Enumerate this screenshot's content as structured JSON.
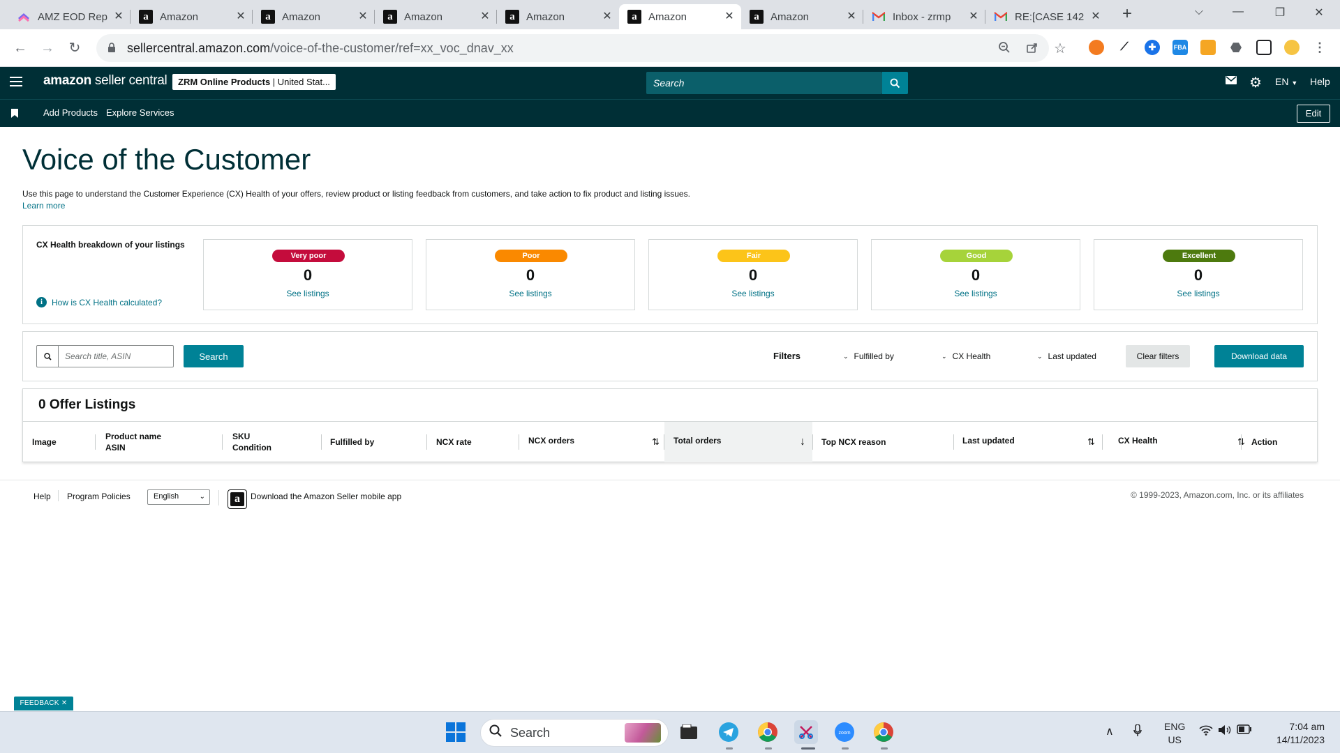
{
  "browser": {
    "tabs": [
      {
        "title": "AMZ EOD Rep",
        "favicon": "clickup-icon",
        "active": false
      },
      {
        "title": "Amazon",
        "favicon": "amazon-icon",
        "active": false
      },
      {
        "title": "Amazon",
        "favicon": "amazon-icon",
        "active": false
      },
      {
        "title": "Amazon",
        "favicon": "amazon-icon",
        "active": false
      },
      {
        "title": "Amazon",
        "favicon": "amazon-icon",
        "active": false
      },
      {
        "title": "Amazon",
        "favicon": "amazon-icon",
        "active": true
      },
      {
        "title": "Amazon",
        "favicon": "amazon-icon",
        "active": false
      },
      {
        "title": "Inbox - zrmp",
        "favicon": "gmail-icon",
        "active": false
      },
      {
        "title": "RE:[CASE 142",
        "favicon": "gmail-icon",
        "active": false
      }
    ],
    "url_host": "sellercentral.amazon.com",
    "url_path": "/voice-of-the-customer/ref=xx_voc_dnav_xx"
  },
  "header": {
    "logo_bold": "amazon",
    "logo_rest": " seller central",
    "account_bold": "ZRM Online Products",
    "account_rest": " | United Stat...",
    "search_placeholder": "Search",
    "language": "EN",
    "help": "Help"
  },
  "subnav": {
    "items": [
      "Add Products",
      "Explore Services"
    ],
    "edit": "Edit"
  },
  "page": {
    "title": "Voice of the Customer",
    "description": "Use this page to understand the Customer Experience (CX) Health of your offers, review product or listing feedback from customers, and take action to fix product and listing issues.",
    "learn_more": "Learn more"
  },
  "cx_health": {
    "label": "CX Health breakdown of your listings",
    "how_link": "How is CX Health calculated?",
    "cards": [
      {
        "badge": "Very poor",
        "count": "0",
        "link": "See listings",
        "color": "#c40c3c"
      },
      {
        "badge": "Poor",
        "count": "0",
        "link": "See listings",
        "color": "#fa8900"
      },
      {
        "badge": "Fair",
        "count": "0",
        "link": "See listings",
        "color": "#fcc419"
      },
      {
        "badge": "Good",
        "count": "0",
        "link": "See listings",
        "color": "#a6d33a"
      },
      {
        "badge": "Excellent",
        "count": "0",
        "link": "See listings",
        "color": "#4d7a0e"
      }
    ]
  },
  "filters": {
    "search_placeholder": "Search title, ASIN",
    "search_button": "Search",
    "label": "Filters",
    "dropdowns": [
      "Fulfilled by",
      "CX Health",
      "Last updated"
    ],
    "clear": "Clear filters",
    "download": "Download data"
  },
  "table": {
    "title": "0 Offer Listings",
    "columns": [
      {
        "line1": "Image",
        "line2": ""
      },
      {
        "line1": "Product name",
        "line2": "ASIN"
      },
      {
        "line1": "SKU",
        "line2": "Condition"
      },
      {
        "line1": "Fulfilled by",
        "line2": ""
      },
      {
        "line1": "NCX rate",
        "line2": ""
      },
      {
        "line1": "NCX orders",
        "line2": ""
      },
      {
        "line1": "Total orders",
        "line2": ""
      },
      {
        "line1": "Top NCX reason",
        "line2": ""
      },
      {
        "line1": "Last updated",
        "line2": ""
      },
      {
        "line1": "CX Health",
        "line2": ""
      },
      {
        "line1": "Action",
        "line2": ""
      }
    ]
  },
  "footer": {
    "help": "Help",
    "policies": "Program Policies",
    "language": "English",
    "app": "Download the Amazon Seller mobile app",
    "copyright": "© 1999-2023, Amazon.com, Inc. or its affiliates"
  },
  "feedback": "FEEDBACK ✕",
  "taskbar": {
    "search": "Search",
    "lang1": "ENG",
    "lang2": "US",
    "time": "7:04 am",
    "date": "14/11/2023"
  },
  "colors": {
    "header": "#002f36",
    "teal": "#008296",
    "link": "#007185"
  }
}
